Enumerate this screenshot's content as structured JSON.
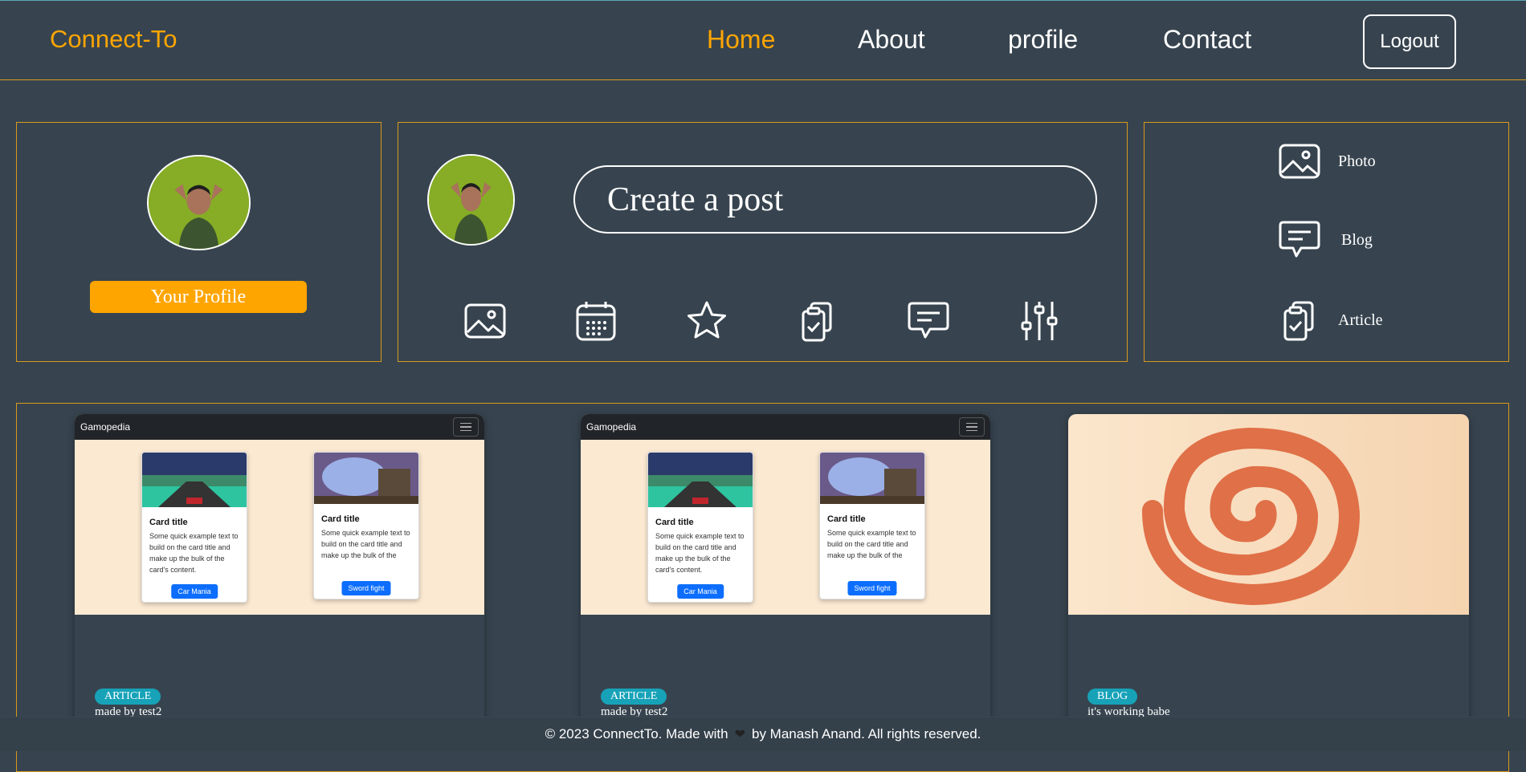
{
  "nav": {
    "brand": "Connect-To",
    "links": [
      {
        "label": "Home",
        "active": true
      },
      {
        "label": "About"
      },
      {
        "label": "profile"
      },
      {
        "label": "Contact"
      }
    ],
    "logout_label": "Logout"
  },
  "profile_panel": {
    "button_label": "Your Profile"
  },
  "post_panel": {
    "placeholder": "Create a post",
    "tool_icons": [
      "image-icon",
      "calendar-icon",
      "star-icon",
      "clipboard-check-icon",
      "chat-icon",
      "sliders-icon"
    ]
  },
  "side_panel": {
    "items": [
      {
        "label": "Photo",
        "icon": "image-icon"
      },
      {
        "label": "Blog",
        "icon": "chat-icon"
      },
      {
        "label": "Article",
        "icon": "clipboard-check-icon"
      }
    ]
  },
  "feed": {
    "cards": [
      {
        "thumb": {
          "site_title": "Gamopedia",
          "cards": [
            {
              "title": "Card title",
              "text": "Some quick example text to build on the card title and make up the bulk of the card's content.",
              "button": "Car Mania"
            },
            {
              "title": "Card title",
              "text": "Some quick example text to build on the card title and make up the bulk of the",
              "button": "Sword fight"
            }
          ]
        },
        "badge": "ARTICLE",
        "caption": "made by test2"
      },
      {
        "thumb": {
          "site_title": "Gamopedia",
          "cards": [
            {
              "title": "Card title",
              "text": "Some quick example text to build on the card title and make up the bulk of the card's content.",
              "button": "Car Mania"
            },
            {
              "title": "Card title",
              "text": "Some quick example text to build on the card title and make up the bulk of the",
              "button": "Sword fight"
            }
          ]
        },
        "badge": "ARTICLE",
        "caption": "made by test2"
      },
      {
        "badge": "BLOG",
        "caption": "it's working babe"
      }
    ]
  },
  "footer": {
    "left": "© 2023 ConnectTo. Made with",
    "heart": "❤",
    "right": "by Manash Anand. All rights reserved."
  },
  "colors": {
    "accent": "#ffa500",
    "background": "#37444f",
    "badge": "#17a2b8",
    "border": "#d99a1c"
  }
}
